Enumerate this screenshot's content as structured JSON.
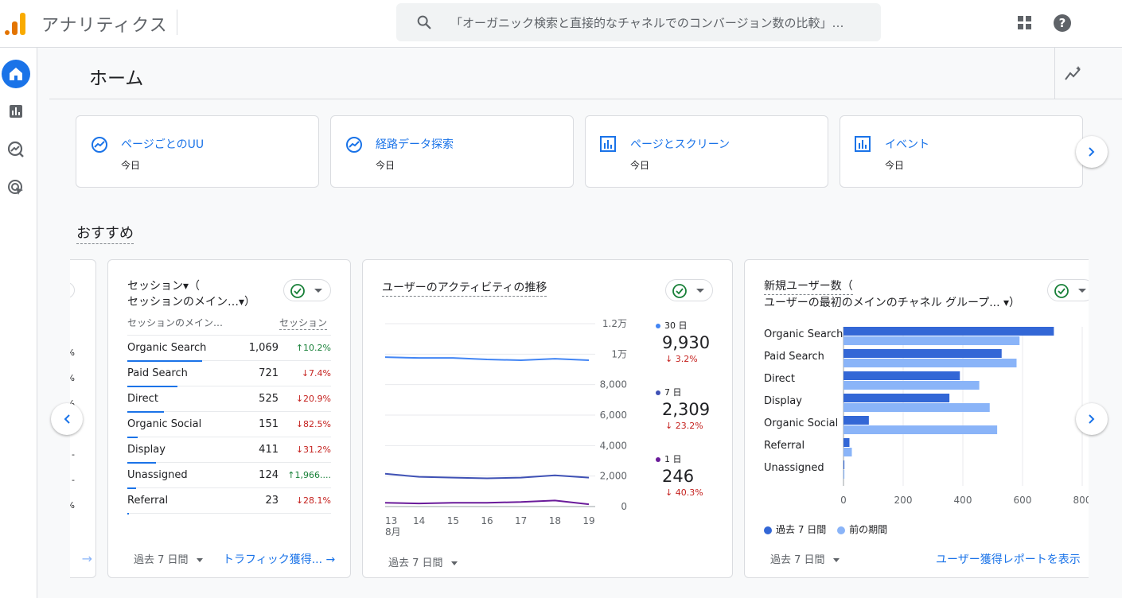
{
  "header": {
    "app_title": "アナリティクス",
    "search_placeholder": "「オーガニック検索と直接的なチャネルでのコンバージョン数の比較」…"
  },
  "page": {
    "title": "ホーム"
  },
  "quick_cards": [
    {
      "label": "ページごとのUU",
      "sub": "今日",
      "icon": "trend-icon"
    },
    {
      "label": "経路データ探索",
      "sub": "今日",
      "icon": "trend-icon"
    },
    {
      "label": "ページとスクリーン",
      "sub": "今日",
      "icon": "bar-report-icon"
    },
    {
      "label": "イベント",
      "sub": "今日",
      "icon": "bar-report-icon"
    }
  ],
  "section": {
    "title": "おすすめ"
  },
  "partial_card": {
    "rows": [
      "%",
      "%",
      "%",
      "-",
      "-",
      "-",
      "%"
    ]
  },
  "sessions_card": {
    "title_line1": "セッション▾（",
    "title_line2": "セッションのメイン…▾）",
    "col_dim": "セッションのメイン…",
    "col_metric": "セッション",
    "rows": [
      {
        "name": "Organic Search",
        "value": "1,069",
        "change": "10.2%",
        "dir": "up",
        "share": 1.0
      },
      {
        "name": "Paid Search",
        "value": "721",
        "change": "7.4%",
        "dir": "down",
        "share": 0.67
      },
      {
        "name": "Direct",
        "value": "525",
        "change": "20.9%",
        "dir": "down",
        "share": 0.49
      },
      {
        "name": "Organic Social",
        "value": "151",
        "change": "82.5%",
        "dir": "down",
        "share": 0.14
      },
      {
        "name": "Display",
        "value": "411",
        "change": "31.2%",
        "dir": "down",
        "share": 0.38
      },
      {
        "name": "Unassigned",
        "value": "124",
        "change": "1,966....",
        "dir": "up",
        "share": 0.12
      },
      {
        "name": "Referral",
        "value": "23",
        "change": "28.1%",
        "dir": "down",
        "share": 0.02
      }
    ],
    "footer_period": "過去 7 日間",
    "footer_link": "トラフィック獲得..."
  },
  "activity_card": {
    "title": "ユーザーのアクティビティの推移",
    "kpis": [
      {
        "label": "30 日",
        "value": "9,930",
        "change": "3.2%",
        "color": "#4285f4"
      },
      {
        "label": "7 日",
        "value": "2,309",
        "change": "23.2%",
        "color": "#3f51b5"
      },
      {
        "label": "1 日",
        "value": "246",
        "change": "40.3%",
        "color": "#6a1b9a"
      }
    ],
    "footer_period": "過去 7 日間"
  },
  "new_users_card": {
    "title_line1": "新規ユーザー数（",
    "title_line2": "ユーザーの最初のメインのチャネル グループ... ▾）",
    "legend_current": "過去 7 日間",
    "legend_previous": "前の期間",
    "footer_period": "過去 7 日間",
    "footer_link": "ユーザー獲得レポートを表示"
  },
  "chart_data": [
    {
      "type": "line",
      "x": [
        "13",
        "14",
        "15",
        "16",
        "17",
        "18",
        "19"
      ],
      "x_sublabel": "8月",
      "y_ticks": [
        "0",
        "2,000",
        "4,000",
        "6,000",
        "8,000",
        "1万",
        "1.2万"
      ],
      "ylim": [
        0,
        12000
      ],
      "series": [
        {
          "name": "30 日",
          "color": "#4285f4",
          "values": [
            9800,
            9750,
            9750,
            9650,
            9600,
            9700,
            9600
          ]
        },
        {
          "name": "7 日",
          "color": "#3f51b5",
          "values": [
            2150,
            1950,
            1900,
            1850,
            1900,
            2050,
            1900
          ]
        },
        {
          "name": "1 日",
          "color": "#6a1b9a",
          "values": [
            250,
            200,
            250,
            250,
            300,
            400,
            150
          ]
        }
      ]
    },
    {
      "type": "bar",
      "orientation": "horizontal",
      "categories": [
        "Organic Search",
        "Paid Search",
        "Direct",
        "Display",
        "Organic Social",
        "Referral",
        "Unassigned"
      ],
      "x_ticks": [
        "0",
        "200",
        "400",
        "600",
        "800"
      ],
      "xlim": [
        0,
        800
      ],
      "series": [
        {
          "name": "過去 7 日間",
          "color": "#3367d6",
          "values": [
            705,
            530,
            390,
            355,
            85,
            20,
            3
          ]
        },
        {
          "name": "前の期間",
          "color": "#8ab4f8",
          "values": [
            590,
            580,
            455,
            490,
            515,
            28,
            3
          ]
        }
      ]
    }
  ]
}
